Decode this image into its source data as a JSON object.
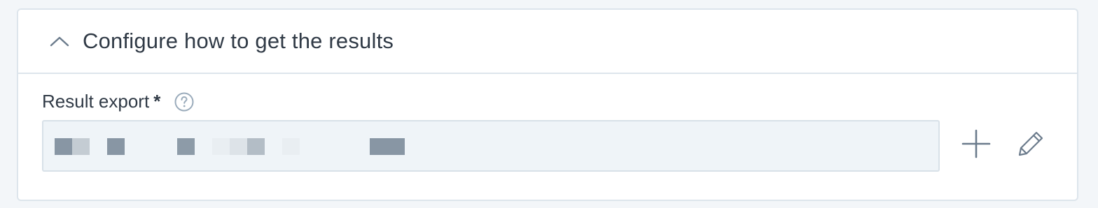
{
  "section": {
    "title": "Configure how to get the results",
    "expanded": true
  },
  "field": {
    "label": "Result export",
    "required_marker": "*",
    "value": ""
  },
  "icons": {
    "collapse": "chevron-up-icon",
    "help": "help-circle-icon",
    "add": "plus-icon",
    "edit": "pencil-icon"
  },
  "colors": {
    "text": "#303a46",
    "border": "#dde5ec",
    "input_bg": "#eff4f8",
    "icon": "#6b7b8c"
  }
}
